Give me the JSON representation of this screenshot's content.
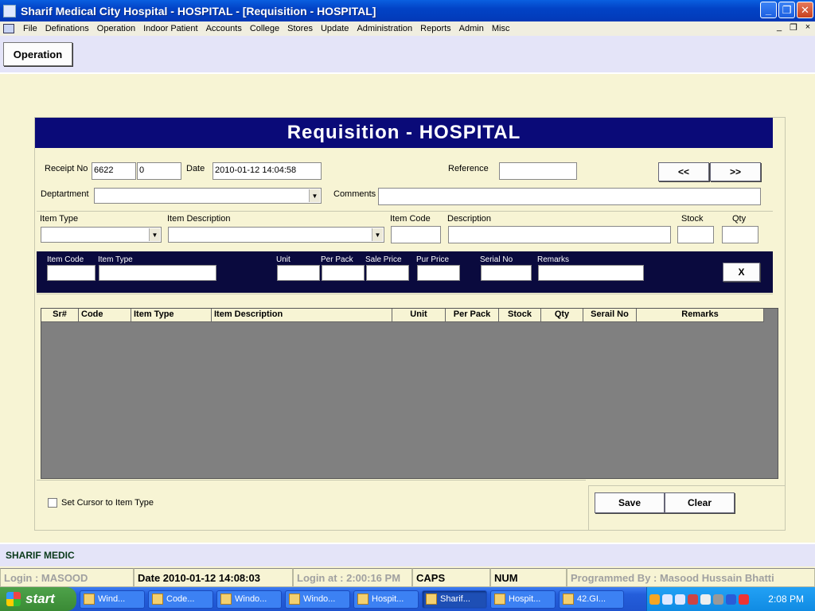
{
  "window": {
    "title": "Sharif Medical City Hospital - HOSPITAL - [Requisition - HOSPITAL]",
    "minimize": "_",
    "maximize": "❐",
    "close": "✕"
  },
  "menu": {
    "items": [
      "File",
      "Definations",
      "Operation",
      "Indoor Patient",
      "Accounts",
      "College",
      "Stores",
      "Update",
      "Administration",
      "Reports",
      "Admin",
      "Misc"
    ],
    "mdi_min": "_",
    "mdi_restore": "❐",
    "mdi_close": "×"
  },
  "toolbar": {
    "operation": "Operation"
  },
  "form": {
    "title": "Requisition - HOSPITAL",
    "receipt_no_label": "Receipt No",
    "receipt_no": "6622",
    "receipt_sub": "0",
    "date_label": "Date",
    "date": "2010-01-12 14:04:58",
    "reference_label": "Reference",
    "reference": "",
    "prev": "<<",
    "next": ">>",
    "department_label": "Deptartment",
    "department": "",
    "comments_label": "Comments",
    "comments": "",
    "item_type_label": "Item Type",
    "item_desc_label": "Item Description",
    "item_code_label": "Item Code",
    "description_label": "Description",
    "stock_label": "Stock",
    "qty_label": "Qty",
    "entry": {
      "item_code": "Item Code",
      "item_type": "Item Type",
      "unit": "Unit",
      "per_pack": "Per Pack",
      "sale_price": "Sale Price",
      "pur_price": "Pur Price",
      "serial_no": "Serial No",
      "remarks": "Remarks",
      "x_button": "X"
    },
    "grid": {
      "columns": [
        "Sr#",
        "Code",
        "Item Type",
        "Item Description",
        "Unit",
        "Per Pack",
        "Stock",
        "Qty",
        "Serail No",
        "Remarks"
      ]
    },
    "cursor_checkbox": "Set Cursor to Item Type",
    "save": "Save",
    "clear": "Clear"
  },
  "footer": {
    "brand": "SHARIF MEDIC"
  },
  "status": {
    "login": "Login :  MASOOD",
    "date": "Date 2010-01-12 14:08:03",
    "login_at": "Login at : 2:00:16 PM",
    "caps": "CAPS",
    "num": "NUM",
    "programmer": "Programmed By : Masood Hussain Bhatti"
  },
  "taskbar": {
    "start": "start",
    "tasks": [
      "Wind...",
      "Code...",
      "Windo...",
      "Windo...",
      "Hospit...",
      "Sharif...",
      "Hospit...",
      "42.GI..."
    ],
    "clock": "2:08 PM"
  },
  "colors": {
    "title_blue": "#0a0a78",
    "form_bg": "#f7f4d4",
    "grid_bg": "#808080"
  }
}
